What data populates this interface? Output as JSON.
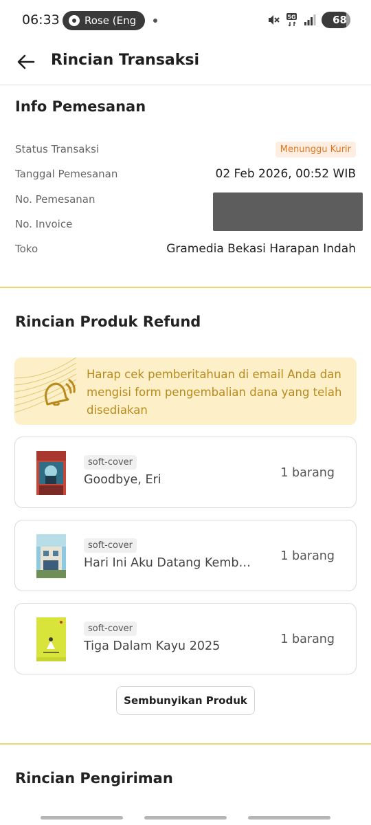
{
  "status_bar": {
    "time": "06:33",
    "media_label": "Rose (Eng",
    "battery": "68"
  },
  "header": {
    "title": "Rincian Transaksi"
  },
  "order_info": {
    "title": "Info Pemesanan",
    "rows": [
      {
        "label": "Status Transaksi",
        "value": "Menunggu Kurir"
      },
      {
        "label": "Tanggal Pemesanan",
        "value": "02 Feb 2026, 00:52 WIB"
      },
      {
        "label": "No. Pemesanan",
        "value": ""
      },
      {
        "label": "No. Invoice",
        "value": ""
      },
      {
        "label": "Toko",
        "value": "Gramedia Bekasi Harapan Indah"
      }
    ]
  },
  "refund": {
    "title": "Rincian Produk Refund",
    "notice": "Harap cek pemberitahuan di email Anda dan mengisi form pengembalian dana yang telah disediakan",
    "products": [
      {
        "tag": "soft-cover",
        "name": "Goodbye, Eri",
        "qty": "1 barang"
      },
      {
        "tag": "soft-cover",
        "name": "Hari Ini Aku Datang Kembali",
        "qty": "1 barang"
      },
      {
        "tag": "soft-cover",
        "name": "Tiga Dalam Kayu 2025",
        "qty": "1 barang"
      }
    ],
    "hide_button": "Sembunyikan Produk"
  },
  "shipping": {
    "title": "Rincian Pengiriman"
  },
  "colors": {
    "accent_divider": "#f1d571",
    "notice_bg": "#fdf0c8",
    "notice_text": "#b8891b",
    "status_badge_bg": "#fdeee1",
    "status_badge_text": "#e0781f"
  }
}
